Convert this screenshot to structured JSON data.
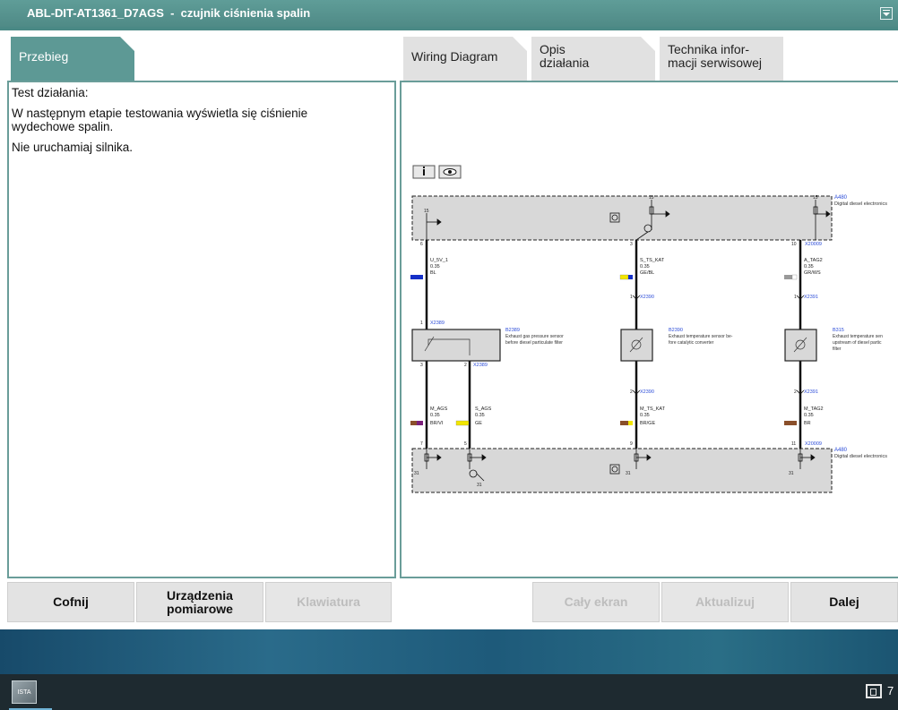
{
  "window": {
    "title": "ABL-DIT-AT1361_D7AGS  -  czujnik ciśnienia spalin"
  },
  "tabs": {
    "left": {
      "label": "Przebieg"
    },
    "right": [
      {
        "label": "Wiring Diagram"
      },
      {
        "line1": "Opis",
        "line2": "działania"
      },
      {
        "line1": "Technika infor-",
        "line2": "macji serwisowej"
      }
    ]
  },
  "text_panel": {
    "paragraphs": [
      "Test działania:",
      "W następnym etapie testowania wyświetla się ciśnienie wydechowe spalin.",
      "Nie uruchamiaj silnika."
    ]
  },
  "diagram": {
    "top_box": {
      "ref": "A480",
      "label": "Digital diesel electronics",
      "fuse": "15"
    },
    "bottom_box": {
      "ref": "A480",
      "label": "Digital diesel electronics",
      "ground": "31"
    },
    "columns": [
      {
        "top_pin": "6",
        "top_wire_name": "U_5V_1",
        "top_wire_size": "0.35",
        "top_color_code": "BL",
        "top_color": "#1530c8",
        "sensor_connector": "X2389",
        "sensor_pin_top": "1",
        "sensor_ref": "B2389",
        "sensor_line1": "Exhaust gas pressure sensor",
        "sensor_line2": "before diesel particulate filter",
        "sensor_pin_bottom": "3",
        "sensor_pin_bottom2": "2",
        "sensor_connector_bottom2": "X2389",
        "bot_wire_name": "M_AGS",
        "bot_wire_size": "0.35",
        "bot_color_code": "BR/VI",
        "bot_color": "#8a4f2a",
        "bot_color2": "#7a1f7a",
        "bot_wire_name2": "S_AGS",
        "bot_wire_size2": "0.35",
        "bot_color_code2": "GE",
        "bot_color3": "#f2e600",
        "bottom_pin": "7",
        "bottom_pin2": "5"
      },
      {
        "top_pin": "3",
        "top_wire_name": "S_TS_KAT",
        "top_wire_size": "0.35",
        "top_color_code": "GE/BL",
        "top_color": "#f2e600",
        "top_color2": "#1530c8",
        "upper_connector": "X2390",
        "upper_pin": "1",
        "sensor_ref": "B2390",
        "sensor_line1": "Exhaust temperature sensor be-",
        "sensor_line2": "fore catalytic converter",
        "lower_connector": "X2390",
        "lower_pin": "2",
        "bot_wire_name": "M_TS_KAT",
        "bot_wire_size": "0.35",
        "bot_color_code": "BR/GE",
        "bot_color": "#8a4f2a",
        "bot_color2": "#f2e600",
        "bottom_pin": "9"
      },
      {
        "top_pin": "10",
        "top_connector": "X20009",
        "top_wire_name": "A_TAG2",
        "top_wire_size": "0.35",
        "top_color_code": "GR/WS",
        "top_color": "#9a9a9a",
        "top_color2": "#ffffff",
        "upper_connector": "X2391",
        "upper_pin": "1",
        "sensor_ref": "B315",
        "sensor_line1": "Exhaust temperature sen",
        "sensor_line2": "upstream of diesel partic",
        "sensor_line3": "filter",
        "lower_connector": "X2391",
        "lower_pin": "2",
        "bot_wire_name": "M_TAG2",
        "bot_wire_size": "0.35",
        "bot_color_code": "BR",
        "bot_color": "#8a4f2a",
        "bottom_pin": "11",
        "bottom_connector": "X20009"
      }
    ]
  },
  "buttons": {
    "back": "Cofnij",
    "devices_line1": "Urządzenia",
    "devices_line2": "pomiarowe",
    "keyboard": "Klawiatura",
    "fullscreen": "Cały ekran",
    "update": "Aktualizuj",
    "next": "Dalej"
  },
  "taskbar": {
    "app_label": "ISTA",
    "tray_text": "7"
  }
}
